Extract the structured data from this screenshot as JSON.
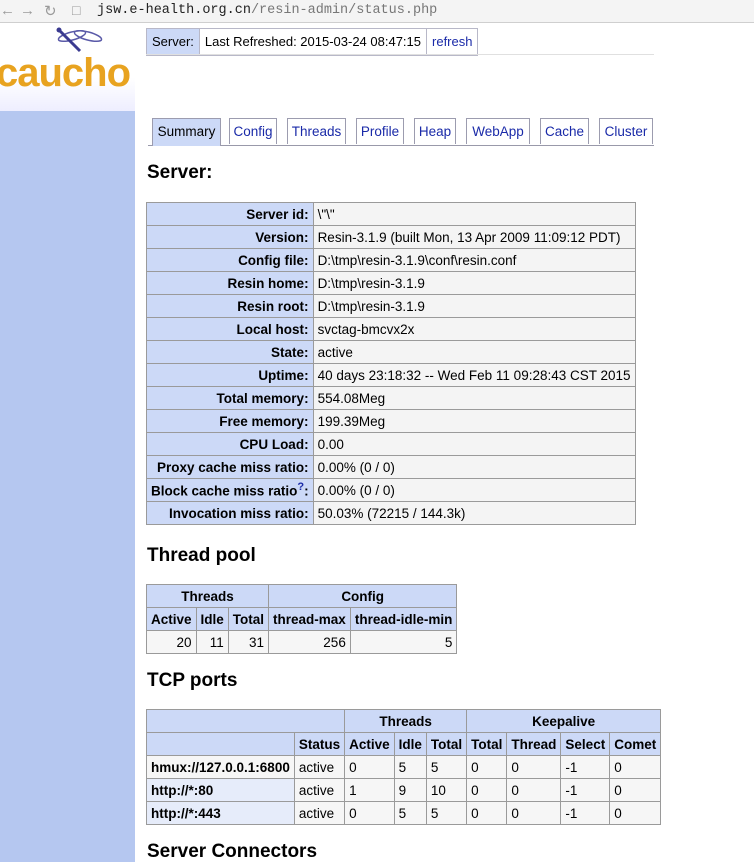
{
  "browser": {
    "url_host": "jsw.e-health.org.cn",
    "url_path": "/resin-admin/status.php"
  },
  "header": {
    "server_label": "Server:",
    "refreshed": "Last Refreshed: 2015-03-24 08:47:15",
    "refresh_link": "refresh",
    "logo_text": "caucho"
  },
  "tabs": [
    "Summary",
    "Config",
    "Threads",
    "Profile",
    "Heap",
    "WebApp",
    "Cache",
    "Cluster"
  ],
  "server": {
    "title": "Server:",
    "rows": [
      {
        "label": "Server id:",
        "value": "\\\"\\\""
      },
      {
        "label": "Version:",
        "value": "Resin-3.1.9 (built Mon, 13 Apr 2009 11:09:12 PDT)"
      },
      {
        "label": "Config file:",
        "value": "D:\\tmp\\resin-3.1.9\\conf\\resin.conf"
      },
      {
        "label": "Resin home:",
        "value": "D:\\tmp\\resin-3.1.9"
      },
      {
        "label": "Resin root:",
        "value": "D:\\tmp\\resin-3.1.9"
      },
      {
        "label": "Local host:",
        "value": "svctag-bmcvx2x"
      },
      {
        "label": "State:",
        "value": "active"
      },
      {
        "label": "Uptime:",
        "value": "40 days 23:18:32 -- Wed Feb 11 09:28:43 CST 2015"
      },
      {
        "label": "Total memory:",
        "value": "554.08Meg"
      },
      {
        "label": "Free memory:",
        "value": "199.39Meg"
      },
      {
        "label": "CPU Load:",
        "value": "0.00"
      },
      {
        "label": "Proxy cache miss ratio:",
        "value": "0.00% (0 / 0)"
      },
      {
        "label": "Block cache miss ratio",
        "help": "?",
        "label_suffix": ":",
        "value": "0.00% (0 / 0)"
      },
      {
        "label": "Invocation miss ratio:",
        "value": "50.03% (72215 / 144.3k)"
      }
    ]
  },
  "thread_pool": {
    "title": "Thread pool",
    "group_threads": "Threads",
    "group_config": "Config",
    "cols": [
      "Active",
      "Idle",
      "Total",
      "thread-max",
      "thread-idle-min"
    ],
    "values": [
      "20",
      "11",
      "31",
      "256",
      "5"
    ]
  },
  "tcp": {
    "title": "TCP ports",
    "group_threads": "Threads",
    "group_keepalive": "Keepalive",
    "cols": [
      "Status",
      "Active",
      "Idle",
      "Total",
      "Total",
      "Thread",
      "Select",
      "Comet"
    ],
    "rows": [
      [
        "hmux://127.0.0.1:6800",
        "active",
        "0",
        "5",
        "5",
        "0",
        "0",
        "-1",
        "0"
      ],
      [
        "http://*:80",
        "active",
        "1",
        "9",
        "10",
        "0",
        "0",
        "-1",
        "0"
      ],
      [
        "http://*:443",
        "active",
        "0",
        "5",
        "5",
        "0",
        "0",
        "-1",
        "0"
      ]
    ]
  },
  "connectors": {
    "title": "Server Connectors"
  }
}
